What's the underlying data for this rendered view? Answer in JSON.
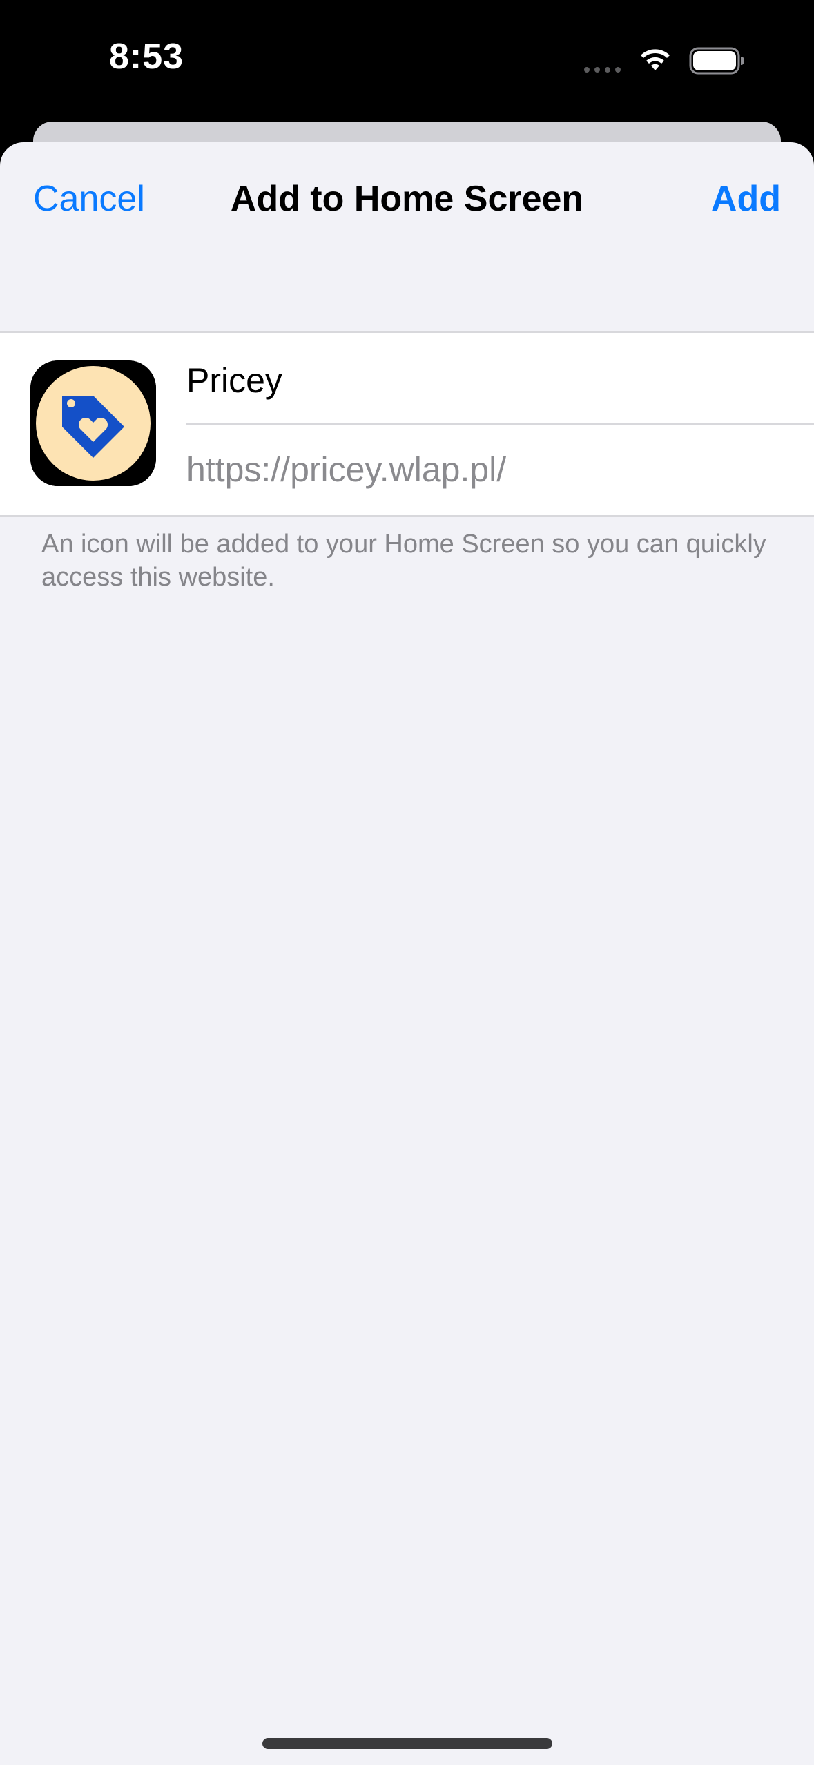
{
  "status_bar": {
    "time": "8:53",
    "icons": [
      "cellular-signal-icon",
      "wifi-icon",
      "battery-icon"
    ]
  },
  "nav": {
    "cancel_label": "Cancel",
    "title": "Add to Home Screen",
    "add_label": "Add"
  },
  "app": {
    "icon": "price-tag-heart-icon",
    "name": "Pricey",
    "url": "https://pricey.wlap.pl/"
  },
  "footer": {
    "note": "An icon will be added to your Home Screen so you can quickly access this website."
  },
  "colors": {
    "accent": "#0a7aff",
    "sheet_background": "#f2f2f7",
    "icon_background": "#fde3b3",
    "icon_tag": "#1450c8"
  }
}
